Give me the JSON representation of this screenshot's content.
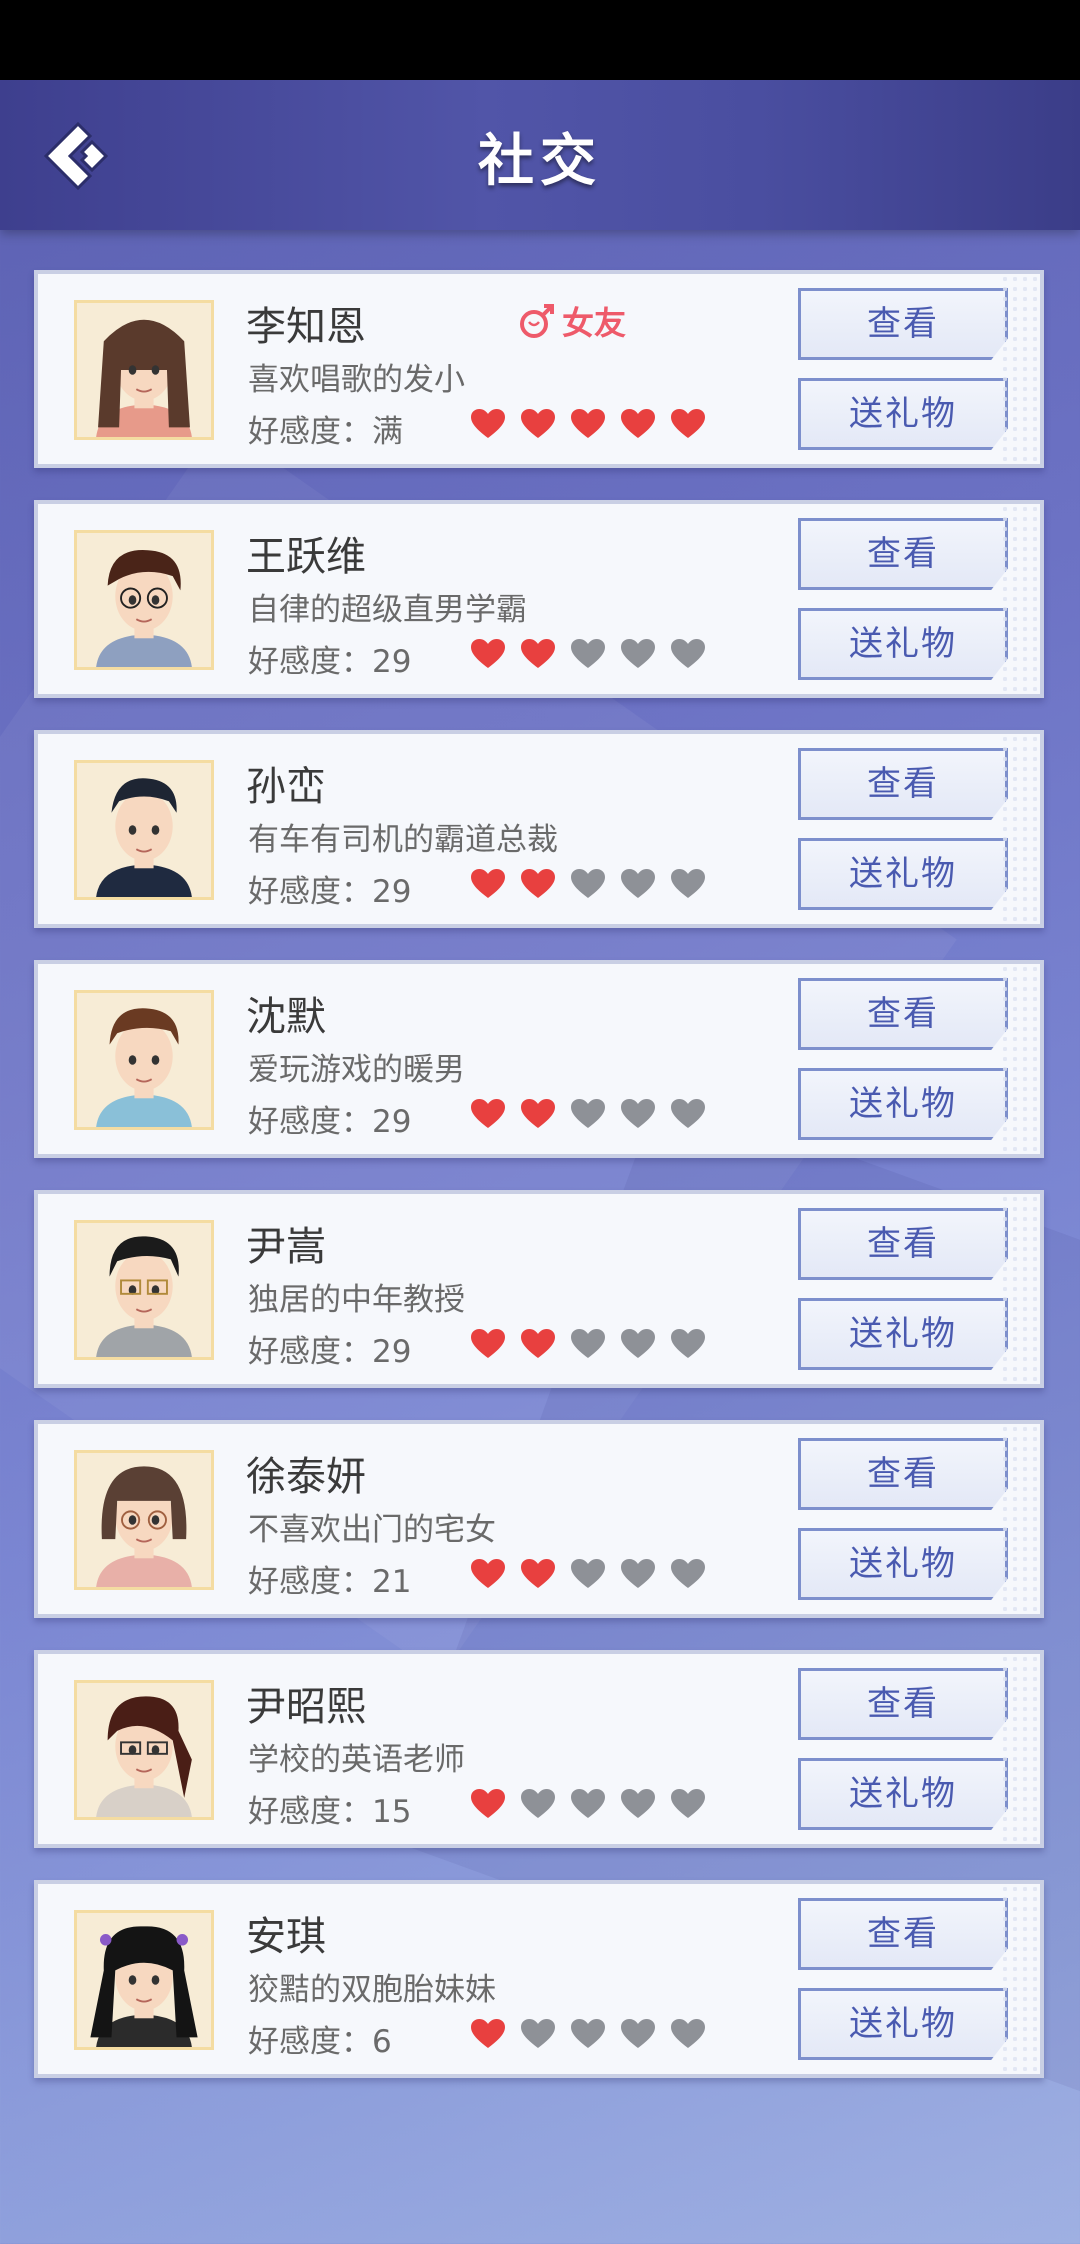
{
  "header": {
    "title": "社交"
  },
  "characters": [
    {
      "name": "李知恩",
      "desc": "喜欢唱歌的发小",
      "favor_label": "好感度：满",
      "hearts_filled": 5,
      "badge": "女友",
      "avatar": "girl-long-brown"
    },
    {
      "name": "王跃维",
      "desc": "自律的超级直男学霸",
      "favor_label": "好感度：29",
      "hearts_filled": 2,
      "avatar": "boy-glasses"
    },
    {
      "name": "孙峦",
      "desc": "有车有司机的霸道总裁",
      "favor_label": "好感度：29",
      "hearts_filled": 2,
      "avatar": "man-suit"
    },
    {
      "name": "沈默",
      "desc": "爱玩游戏的暖男",
      "favor_label": "好感度：29",
      "hearts_filled": 2,
      "avatar": "boy-hoodie"
    },
    {
      "name": "尹嵩",
      "desc": "独居的中年教授",
      "favor_label": "好感度：29",
      "hearts_filled": 2,
      "avatar": "man-glasses"
    },
    {
      "name": "徐泰妍",
      "desc": "不喜欢出门的宅女",
      "favor_label": "好感度：21",
      "hearts_filled": 2,
      "avatar": "girl-bob-glasses"
    },
    {
      "name": "尹昭熙",
      "desc": "学校的英语老师",
      "favor_label": "好感度：15",
      "hearts_filled": 1,
      "avatar": "woman-ponytail"
    },
    {
      "name": "安琪",
      "desc": "狡黠的双胞胎妹妹",
      "favor_label": "好感度：6",
      "hearts_filled": 1,
      "avatar": "girl-twintails"
    }
  ],
  "hearts_total": 5,
  "buttons": {
    "view": "查看",
    "gift": "送礼物"
  },
  "colors": {
    "heart_on": "#e8403f",
    "heart_off": "#8e9197",
    "badge": "#ee5a6a"
  }
}
